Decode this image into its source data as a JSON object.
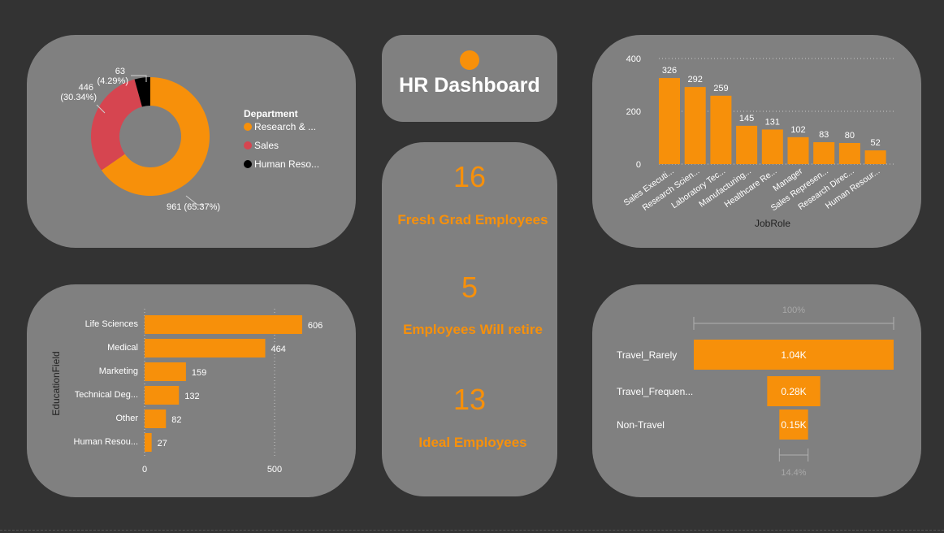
{
  "title_card": {
    "title": "HR Dashboard"
  },
  "kpis": [
    {
      "value": "16",
      "label": "Fresh Grad Employees"
    },
    {
      "value": "5",
      "label": "Employees Will retire"
    },
    {
      "value": "13",
      "label": "Ideal Employees"
    }
  ],
  "colors": {
    "accent": "#f7900a",
    "sales": "#d64550",
    "hr": "#000000",
    "card": "#808080",
    "background": "#333333"
  },
  "chart_data": [
    {
      "type": "pie",
      "legend_title": "Department",
      "legend_position": "right",
      "categories": [
        "Research & ...",
        "Sales",
        "Human Reso..."
      ],
      "values": [
        961,
        446,
        63
      ],
      "data_labels": [
        "961 (65.37%)",
        "446 (30.34%)",
        "63 (4.29%)"
      ],
      "colors": [
        "#f7900a",
        "#d64550",
        "#000000"
      ]
    },
    {
      "type": "bar",
      "categories": [
        "Sales Executi...",
        "Research Scien...",
        "Laboratory Tec...",
        "Manufacturing...",
        "Healthcare Re...",
        "Manager",
        "Sales Represen...",
        "Research Direc...",
        "Human Resour..."
      ],
      "values": [
        326,
        292,
        259,
        145,
        131,
        102,
        83,
        80,
        52
      ],
      "xlabel": "JobRole",
      "ylim": [
        0,
        400
      ],
      "yticks": [
        0,
        200,
        400
      ],
      "grid": true
    },
    {
      "type": "bar",
      "orientation": "horizontal",
      "categories": [
        "Life Sciences",
        "Medical",
        "Marketing",
        "Technical Deg...",
        "Other",
        "Human Resou..."
      ],
      "values": [
        606,
        464,
        159,
        132,
        82,
        27
      ],
      "ylabel": "EducationField",
      "xlim": [
        0,
        700
      ],
      "xticks": [
        0,
        500
      ],
      "grid": true
    },
    {
      "type": "bar",
      "subtype": "funnel",
      "categories": [
        "Travel_Rarely",
        "Travel_Frequen...",
        "Non-Travel"
      ],
      "values": [
        1043,
        277,
        150
      ],
      "data_labels": [
        "1.04K",
        "0.28K",
        "0.15K"
      ],
      "top_label": "100%",
      "bottom_label": "14.4%"
    }
  ]
}
